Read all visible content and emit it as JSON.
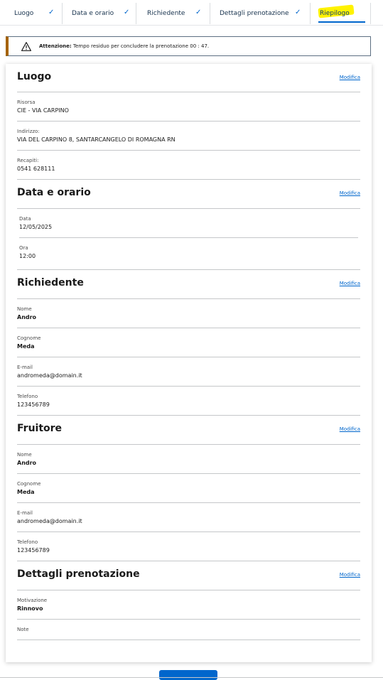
{
  "stepper": {
    "steps": [
      {
        "label": "Luogo",
        "check": "✓"
      },
      {
        "label": "Data e orario",
        "check": "✓"
      },
      {
        "label": "Richiedente",
        "check": "✓"
      },
      {
        "label": "Dettagli prenotazione",
        "check": "✓"
      },
      {
        "label": "Riepilogo"
      }
    ]
  },
  "alert": {
    "strong": "Attenzione:",
    "text": "Tempo residuo per concludere la prenotazione 00 : 47."
  },
  "sections": {
    "luogo": {
      "title": "Luogo",
      "edit": "Modifica",
      "fields": [
        {
          "label": "Risorsa",
          "value": "CIE - VIA CARPINO"
        },
        {
          "label": "Indirizzo:",
          "value": "VIA DEL CARPINO 8, SANTARCANGELO DI ROMAGNA RN"
        },
        {
          "label": "Recapiti:",
          "value": "0541 628111"
        }
      ]
    },
    "data": {
      "title": "Data e orario",
      "edit": "Modifica",
      "fields": [
        {
          "label": "Data",
          "value": "12/05/2025"
        },
        {
          "label": "Ora",
          "value": "12:00"
        }
      ]
    },
    "richiedente": {
      "title": "Richiedente",
      "edit": "Modifica",
      "fields": [
        {
          "label": "Nome",
          "value": "Andro"
        },
        {
          "label": "Cognome",
          "value": "Meda"
        },
        {
          "label": "E-mail",
          "value": "andromeda@domain.it"
        },
        {
          "label": "Telefono",
          "value": "123456789"
        }
      ]
    },
    "fruitore": {
      "title": "Fruitore",
      "edit": "Modifica",
      "fields": [
        {
          "label": "Nome",
          "value": "Andro"
        },
        {
          "label": "Cognome",
          "value": "Meda"
        },
        {
          "label": "E-mail",
          "value": "andromeda@domain.it"
        },
        {
          "label": "Telefono",
          "value": "123456789"
        }
      ]
    },
    "dettagli": {
      "title": "Dettagli prenotazione",
      "edit": "Modifica",
      "fields": [
        {
          "label": "Motivazione",
          "value": "Rinnovo"
        },
        {
          "label": "Note",
          "value": ""
        }
      ]
    }
  },
  "colors": {
    "primary": "#0066cc",
    "alert_border": "#a66300",
    "highlight": "#fff200"
  }
}
